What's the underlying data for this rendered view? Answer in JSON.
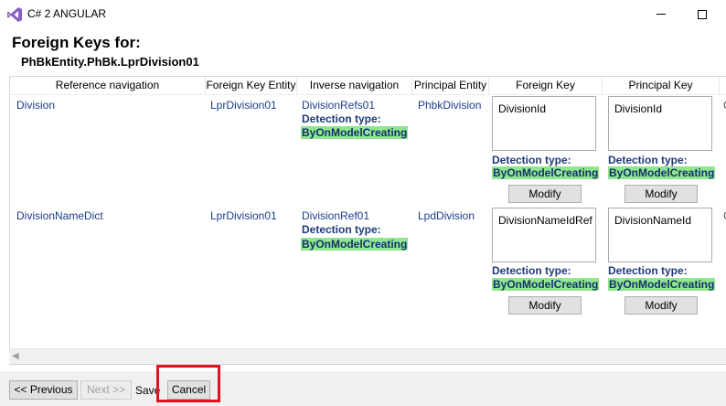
{
  "window": {
    "title": "C# 2 ANGULAR"
  },
  "header": {
    "title": "Foreign Keys for:",
    "entity": "PhBkEntity.PhBk.LprDivision01"
  },
  "columns": [
    "Reference navigation",
    "Foreign Key Entity",
    "Inverse navigation",
    "Principal Entity",
    "Foreign Key",
    "Principal Key"
  ],
  "detection_label": "Detection type:",
  "rows": [
    {
      "reference_navigation": "Division",
      "foreign_key_entity": "LprDivision01",
      "inverse_navigation": "DivisionRefs01",
      "inverse_detection": "ByOnModelCreating",
      "principal_entity": "PhbkDivision",
      "foreign_key": "DivisionId",
      "foreign_key_detection": "ByOnModelCreating",
      "principal_key": "DivisionId",
      "principal_key_detection": "ByOnModelCreating",
      "clipped_next_column": "C"
    },
    {
      "reference_navigation": "DivisionNameDict",
      "foreign_key_entity": "LprDivision01",
      "inverse_navigation": "DivisionRef01",
      "inverse_detection": "ByOnModelCreating",
      "principal_entity": "LpdDivision",
      "foreign_key": "DivisionNameIdRef",
      "foreign_key_detection": "ByOnModelCreating",
      "principal_key": "DivisionNameId",
      "principal_key_detection": "ByOnModelCreating",
      "clipped_next_column": "C"
    }
  ],
  "modify_label": "Modify",
  "footer": {
    "previous_label": "<< Previous",
    "next_label": "Next >>",
    "save_label": "Save",
    "cancel_label": "Cancel"
  },
  "colors": {
    "highlight": "#e0121f",
    "detection_bg": "#8ee68e",
    "link": "#1a3c8c"
  }
}
